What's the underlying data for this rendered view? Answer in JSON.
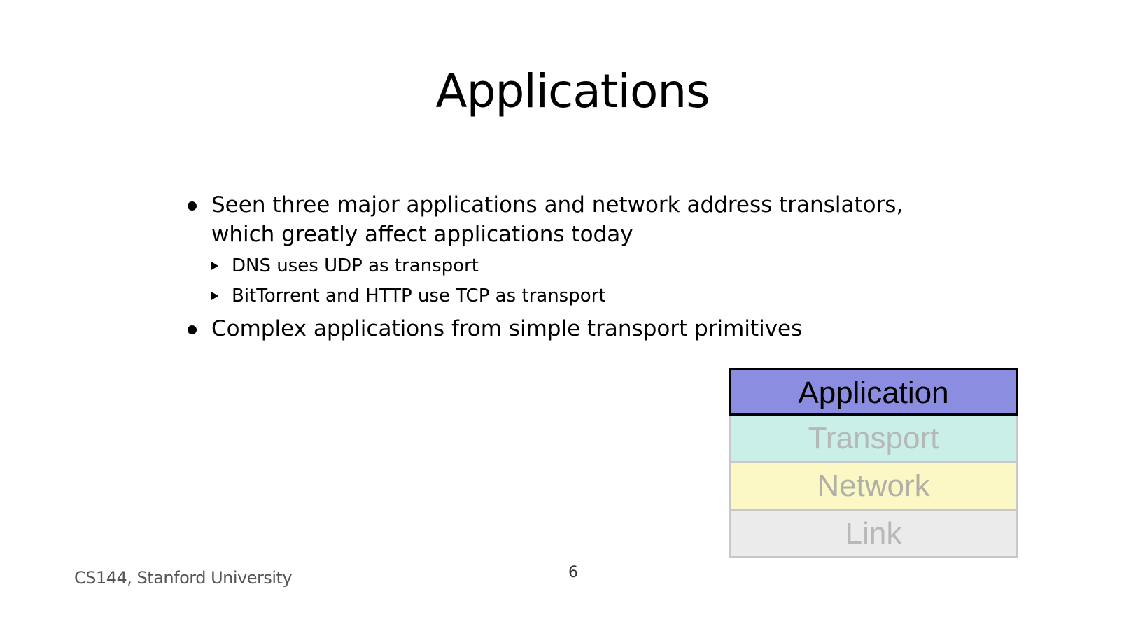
{
  "slide": {
    "title": "Applications",
    "bullets": [
      {
        "text": "Seen three major applications and network address translators, which greatly affect applications today",
        "sub": [
          "DNS uses UDP as transport",
          "BitTorrent and HTTP use TCP as transport"
        ]
      },
      {
        "text": "Complex applications from simple transport primitives"
      }
    ]
  },
  "stack": {
    "layers": [
      "Application",
      "Transport",
      "Network",
      "Link"
    ],
    "colors": {
      "application": "#8b8ee0",
      "transport": "#c9efe8",
      "network": "#fbf8c5",
      "link": "#ebebeb"
    }
  },
  "footer": {
    "course": "CS144, Stanford University",
    "page": "6"
  }
}
